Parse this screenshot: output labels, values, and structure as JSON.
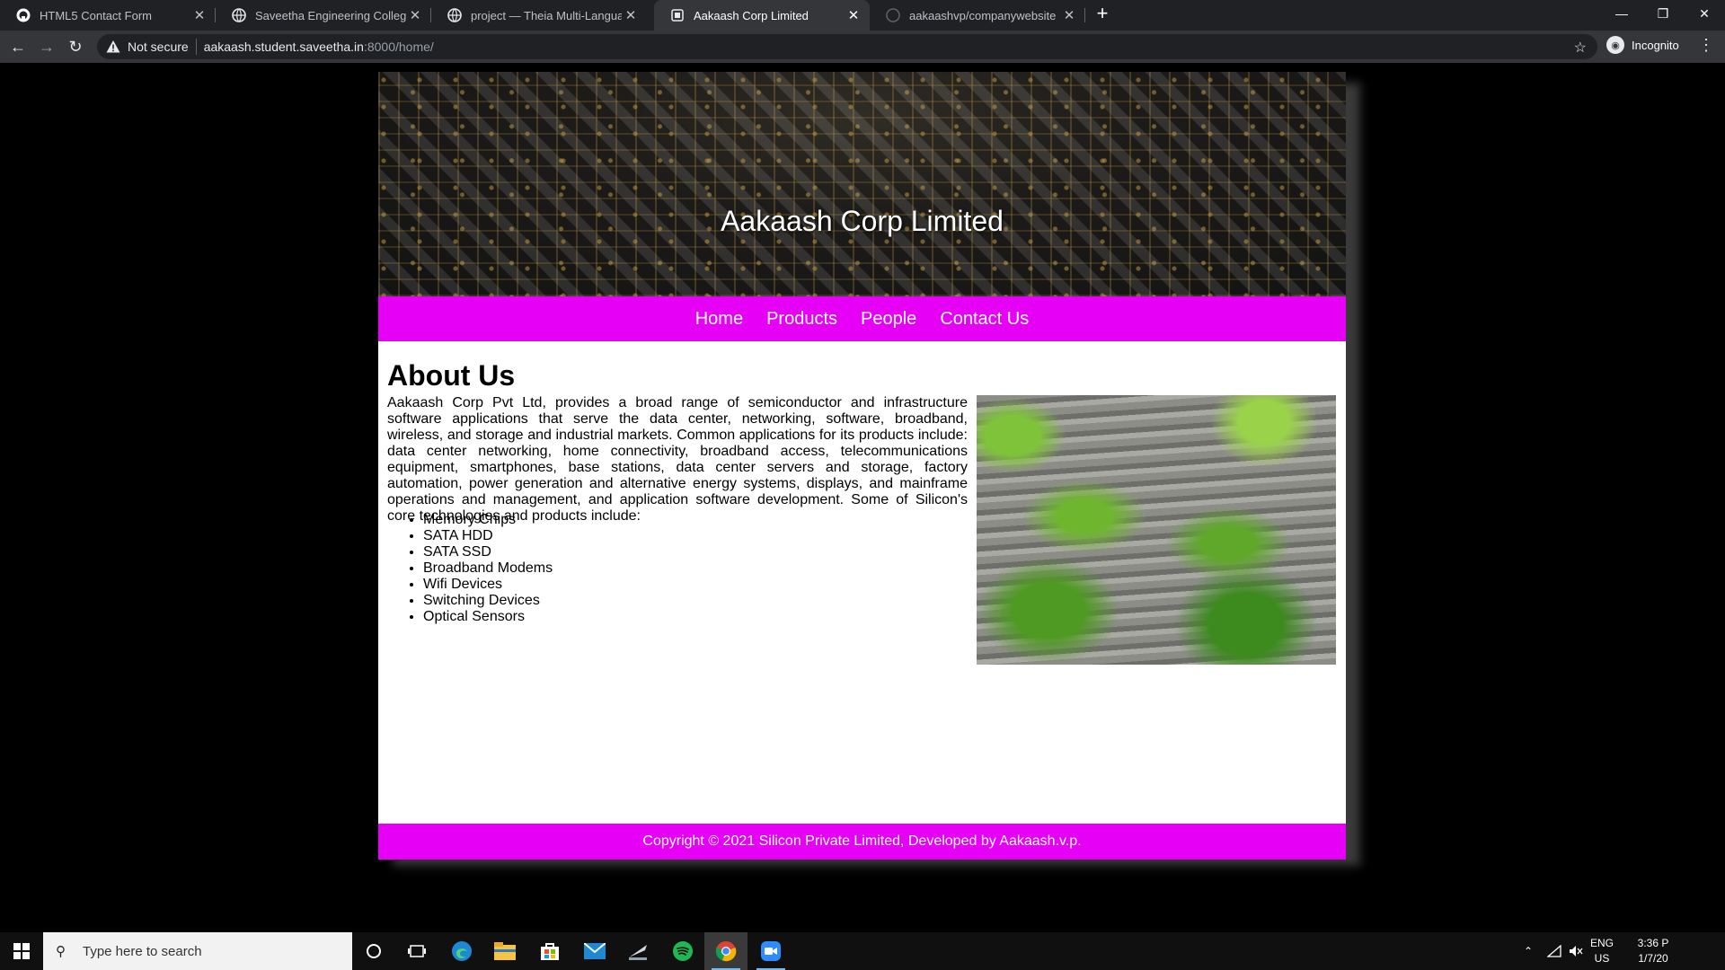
{
  "browser": {
    "tabs": [
      {
        "title": "HTML5 Contact Form",
        "icon": "github-icon"
      },
      {
        "title": "Saveetha Engineering College",
        "icon": "globe-icon"
      },
      {
        "title": "project — Theia Multi-Language",
        "icon": "globe-icon"
      },
      {
        "title": "Aakaash Corp Limited",
        "icon": "page-icon",
        "active": true
      },
      {
        "title": "aakaashvp/companywebsite",
        "icon": "github-icon"
      }
    ],
    "address": {
      "security_label": "Not secure",
      "url_host": "aakaash.student.saveetha.in",
      "url_rest": ":8000/home/"
    },
    "profile_label": "Incognito"
  },
  "site": {
    "banner_title": "Aakaash Corp Limited",
    "nav": [
      "Home",
      "Products",
      "People",
      "Contact Us"
    ],
    "heading": "About Us",
    "about_paragraph": "Aakaash Corp Pvt Ltd, provides a broad range of semiconductor and infrastructure software applications that serve the data center, networking, software, broadband, wireless, and storage and industrial markets. Common applications for its products include: data center networking, home connectivity, broadband access, telecommunications equipment, smartphones, base stations, data center servers and storage, factory automation, power generation and alternative energy systems, displays, and mainframe operations and management, and application software development. Some of Silicon's core technologies and products include:",
    "products": [
      "Memory Chips",
      "SATA HDD",
      "SATA SSD",
      "Broadband Modems",
      "Wifi Devices",
      "Switching Devices",
      "Optical Sensors"
    ],
    "footer": "Copyright © 2021 Silicon Private Limited, Developed by Aakaash.v.p.",
    "accent_color": "#e600f5"
  },
  "taskbar": {
    "search_placeholder": "Type here to search",
    "lang_line1": "ENG",
    "lang_line2": "US",
    "time": "3:36 P",
    "date": "1/7/20"
  }
}
